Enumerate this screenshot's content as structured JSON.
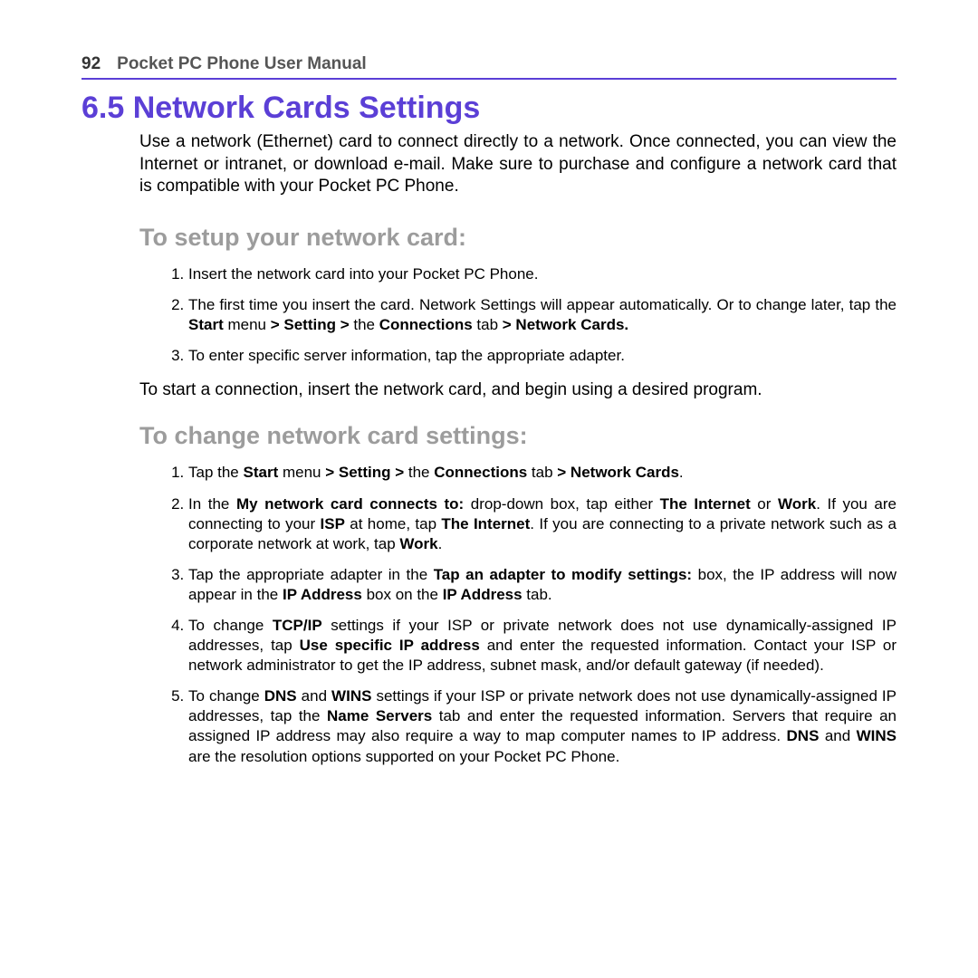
{
  "header": {
    "page_number": "92",
    "manual_title": "Pocket PC Phone User Manual"
  },
  "section": {
    "number_title": "6.5  Network Cards Settings",
    "intro": "Use a network (Ethernet) card to connect directly to a network. Once connected, you can view the Internet or intranet, or download e-mail. Make sure to purchase and configure a network card that is compatible with your Pocket PC Phone."
  },
  "setup": {
    "heading": "To setup your network card:",
    "steps": {
      "s1": "Insert the network card into your Pocket PC Phone.",
      "s2_a": "The first time you insert the card.  Network Settings will appear automatically. Or to change later, tap the ",
      "s2_b": "Start",
      "s2_c": " menu ",
      "s2_d": "> Setting >",
      "s2_e": " the ",
      "s2_f": "Connections",
      "s2_g": " tab ",
      "s2_h": "> Network Cards.",
      "s3": "To enter specific server information, tap the appropriate adapter."
    },
    "after": "To start a connection, insert the network card, and begin using a desired program."
  },
  "change": {
    "heading": "To change network card settings:",
    "s1_a": "Tap the ",
    "s1_b": "Start",
    "s1_c": " menu ",
    "s1_d": "> Setting >",
    "s1_e": " the ",
    "s1_f": "Connections",
    "s1_g": " tab ",
    "s1_h": "> Network Cards",
    "s1_i": ".",
    "s2_a": "In the ",
    "s2_b": "My network card connects to:",
    "s2_c": " drop-down box, tap either ",
    "s2_d": "The Internet",
    "s2_e": " or ",
    "s2_f": "Work",
    "s2_g": ". If you are connecting to your ",
    "s2_h": "ISP",
    "s2_i": " at home, tap ",
    "s2_j": "The Internet",
    "s2_k": ". If you are connecting to a private network such as a corporate network at work, tap ",
    "s2_l": "Work",
    "s2_m": ".",
    "s3_a": "Tap the appropriate adapter in the ",
    "s3_b": "Tap an adapter to modify settings:",
    "s3_c": " box, the IP address will now appear in the ",
    "s3_d": "IP Address",
    "s3_e": " box on the ",
    "s3_f": "IP Address",
    "s3_g": " tab.",
    "s4_a": "To change ",
    "s4_b": "TCP/IP",
    "s4_c": " settings if your ISP or private network does not use dynamically-assigned IP addresses, tap ",
    "s4_d": "Use specific IP address",
    "s4_e": " and enter the requested information. Contact your ISP or network administrator to get the IP address, subnet mask, and/or default gateway (if needed).",
    "s5_a": "To change ",
    "s5_b": "DNS",
    "s5_c": " and ",
    "s5_d": "WINS",
    "s5_e": " settings if your ISP or private network does not use dynamically-assigned IP addresses, tap the ",
    "s5_f": "Name Servers",
    "s5_g": " tab and enter the requested information. Servers that require an assigned IP address may also require a way to map computer names to IP address. ",
    "s5_h": "DNS",
    "s5_i": " and ",
    "s5_j": "WINS",
    "s5_k": " are the resolution options supported on your Pocket PC Phone."
  }
}
